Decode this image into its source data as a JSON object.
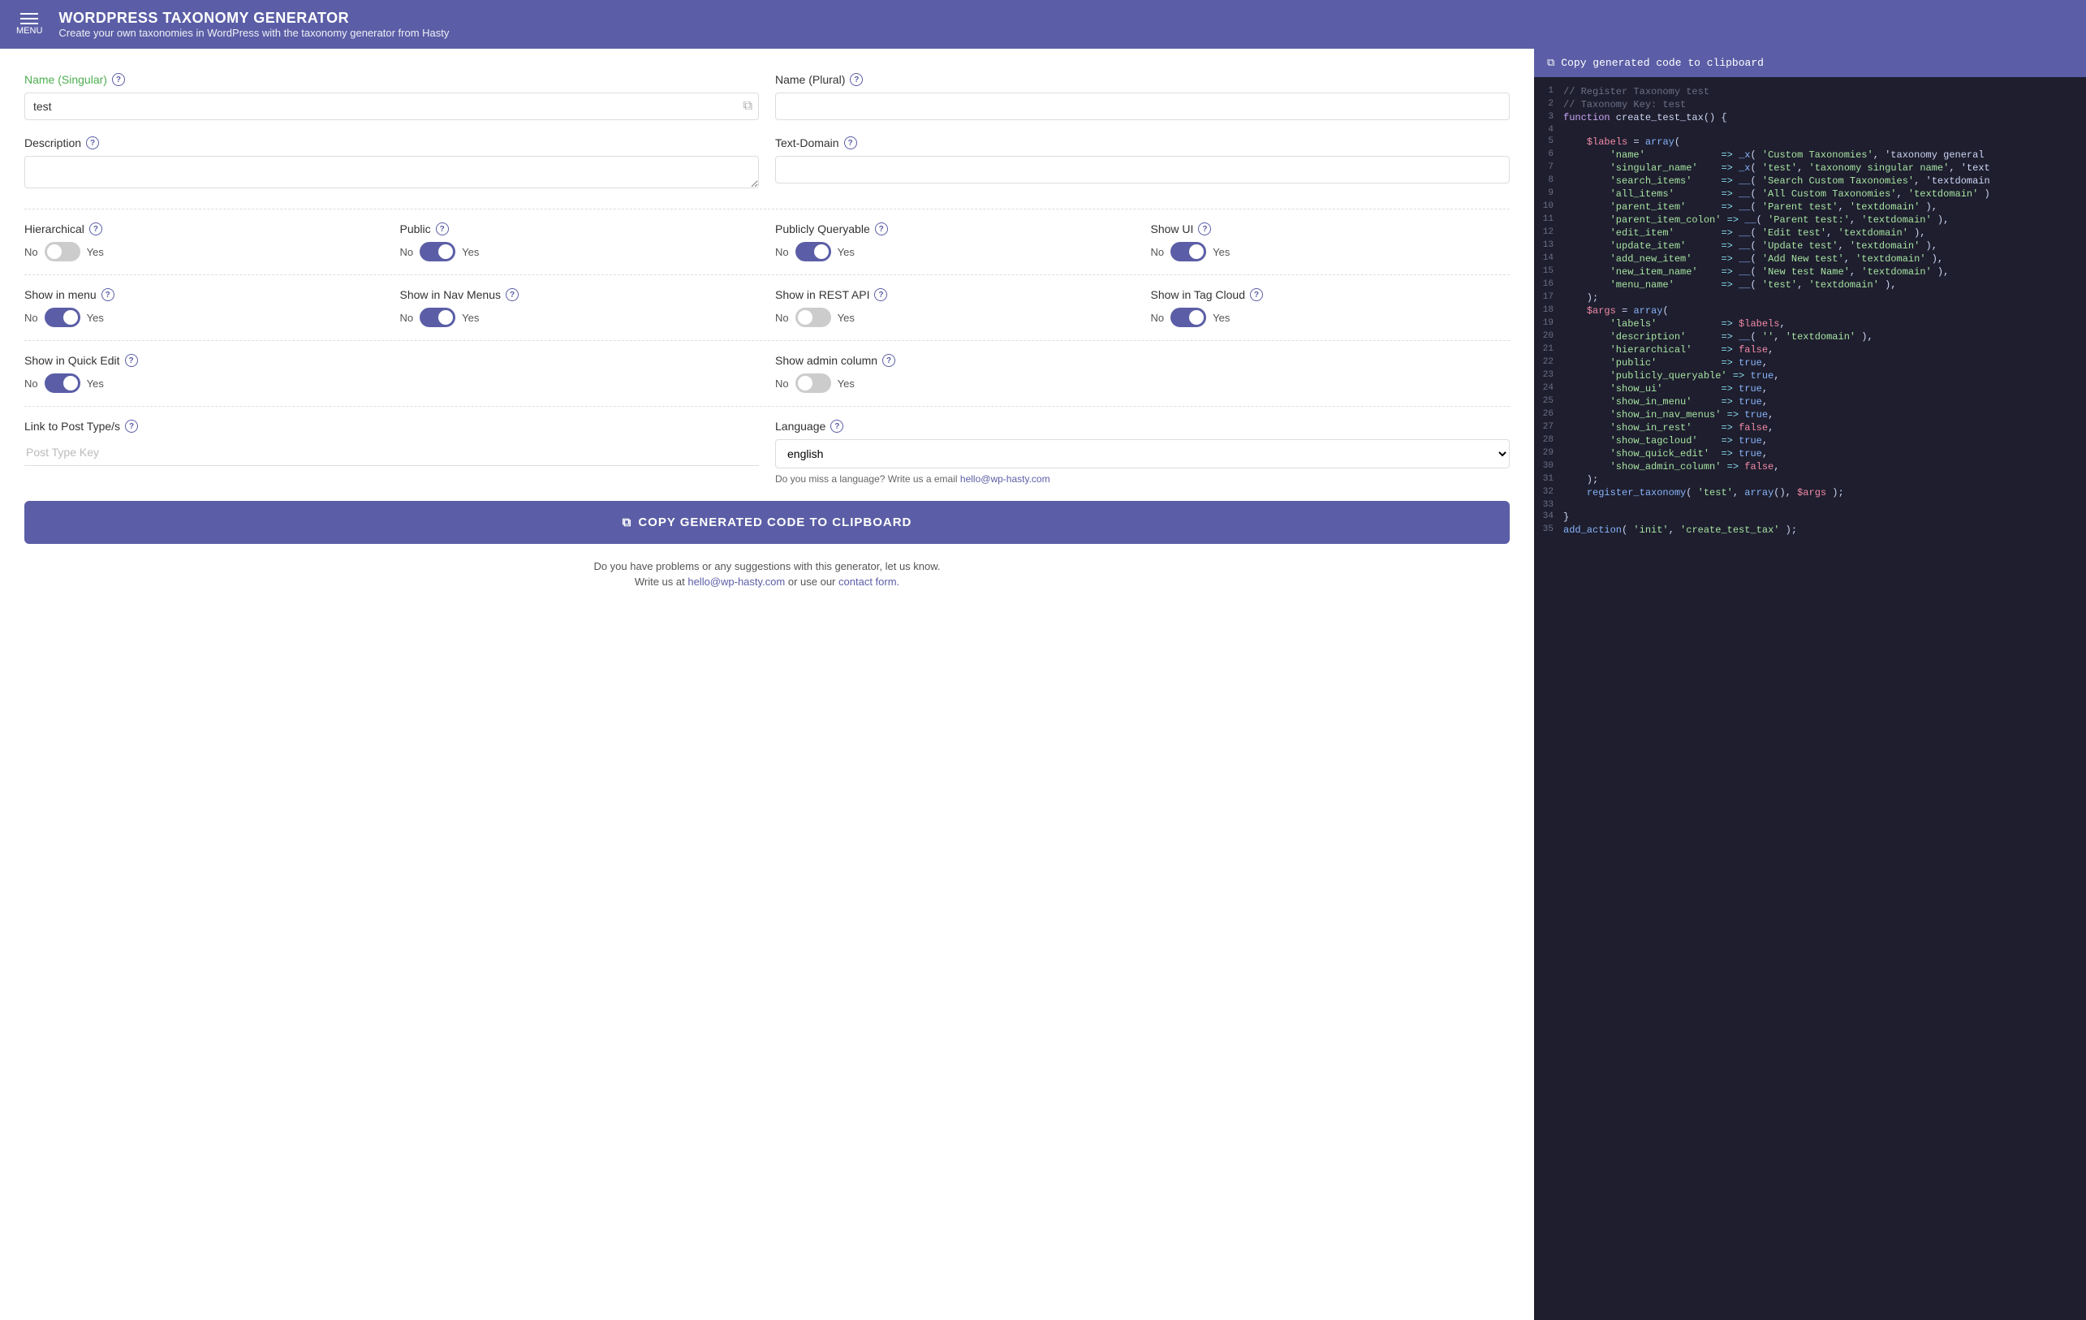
{
  "header": {
    "menu_label": "MENU",
    "title": "WORDPRESS TAXONOMY GENERATOR",
    "subtitle": "Create your own taxonomies in WordPress with the taxonomy generator from Hasty"
  },
  "form": {
    "name_singular_label": "Name (Singular)",
    "name_singular_value": "test",
    "name_plural_label": "Name (Plural)",
    "name_plural_value": "",
    "description_label": "Description",
    "description_value": "",
    "textdomain_label": "Text-Domain",
    "textdomain_value": "",
    "hierarchical_label": "Hierarchical",
    "public_label": "Public",
    "publicly_queryable_label": "Publicly Queryable",
    "show_ui_label": "Show UI",
    "show_in_menu_label": "Show in menu",
    "show_in_nav_menus_label": "Show in Nav Menus",
    "show_in_rest_api_label": "Show in REST API",
    "show_in_tag_cloud_label": "Show in Tag Cloud",
    "show_in_quick_edit_label": "Show in Quick Edit",
    "show_admin_column_label": "Show admin column",
    "link_to_post_types_label": "Link to Post Type/s",
    "post_type_placeholder": "Post Type Key",
    "language_label": "Language",
    "language_value": "english",
    "lang_hint": "Do you miss a language? Write us a email",
    "lang_email": "hello@wp-hasty.com",
    "no_label": "No",
    "yes_label": "Yes",
    "copy_button_label": "COPY GENERATED CODE TO CLIPBOARD",
    "footer_line1": "Do you have problems or any suggestions with this generator, let us know.",
    "footer_line2_pre": "Write us at",
    "footer_email": "hello@wp-hasty.com",
    "footer_mid": "or use our",
    "footer_link": "contact form.",
    "code_header_label": "Copy generated code to clipboard"
  },
  "toggles": {
    "hierarchical": false,
    "public": true,
    "publicly_queryable": true,
    "show_ui": true,
    "show_in_menu": true,
    "show_in_nav_menus": true,
    "show_in_rest": false,
    "show_in_tag_cloud": true,
    "show_in_quick_edit": true,
    "show_admin_column": false
  },
  "code_lines": [
    {
      "num": 1,
      "type": "comment",
      "text": "// Register Taxonomy test"
    },
    {
      "num": 2,
      "type": "comment",
      "text": "// Taxonomy Key: test"
    },
    {
      "num": 3,
      "type": "mixed",
      "text": "function create_test_tax() {"
    },
    {
      "num": 4,
      "type": "plain",
      "text": ""
    },
    {
      "num": 5,
      "type": "mixed",
      "text": "    $labels = array("
    },
    {
      "num": 6,
      "type": "key-val",
      "text": "        'name'             => _x( 'Custom Taxonomies', 'taxonomy general"
    },
    {
      "num": 7,
      "type": "key-val",
      "text": "        'singular_name'    => _x( 'test', 'taxonomy singular name', 'text"
    },
    {
      "num": 8,
      "type": "key-val",
      "text": "        'search_items'     => __( 'Search Custom Taxonomies', 'textdomain"
    },
    {
      "num": 9,
      "type": "key-val",
      "text": "        'all_items'        => __( 'All Custom Taxonomies', 'textdomain' )"
    },
    {
      "num": 10,
      "type": "key-val",
      "text": "        'parent_item'      => __( 'Parent test', 'textdomain' ),"
    },
    {
      "num": 11,
      "type": "key-val",
      "text": "        'parent_item_colon' => __( 'Parent test:', 'textdomain' ),"
    },
    {
      "num": 12,
      "type": "key-val",
      "text": "        'edit_item'        => __( 'Edit test', 'textdomain' ),"
    },
    {
      "num": 13,
      "type": "key-val",
      "text": "        'update_item'      => __( 'Update test', 'textdomain' ),"
    },
    {
      "num": 14,
      "type": "key-val",
      "text": "        'add_new_item'     => __( 'Add New test', 'textdomain' ),"
    },
    {
      "num": 15,
      "type": "key-val",
      "text": "        'new_item_name'    => __( 'New test Name', 'textdomain' ),"
    },
    {
      "num": 16,
      "type": "key-val",
      "text": "        'menu_name'        => __( 'test', 'textdomain' ),"
    },
    {
      "num": 17,
      "type": "plain",
      "text": "    );"
    },
    {
      "num": 18,
      "type": "mixed",
      "text": "    $args = array("
    },
    {
      "num": 19,
      "type": "key-val",
      "text": "        'labels'           => $labels,"
    },
    {
      "num": 20,
      "type": "key-val",
      "text": "        'description'      => __( '', 'textdomain' ),"
    },
    {
      "num": 21,
      "type": "key-val",
      "text": "        'hierarchical'     => false,"
    },
    {
      "num": 22,
      "type": "key-val",
      "text": "        'public'           => true,"
    },
    {
      "num": 23,
      "type": "key-val",
      "text": "        'publicly_queryable' => true,"
    },
    {
      "num": 24,
      "type": "key-val",
      "text": "        'show_ui'          => true,"
    },
    {
      "num": 25,
      "type": "key-val",
      "text": "        'show_in_menu'     => true,"
    },
    {
      "num": 26,
      "type": "key-val",
      "text": "        'show_in_nav_menus' => true,"
    },
    {
      "num": 27,
      "type": "key-val",
      "text": "        'show_in_rest'     => false,"
    },
    {
      "num": 28,
      "type": "key-val",
      "text": "        'show_tagcloud'    => true,"
    },
    {
      "num": 29,
      "type": "key-val",
      "text": "        'show_quick_edit'  => true,"
    },
    {
      "num": 30,
      "type": "key-val",
      "text": "        'show_admin_column' => false,"
    },
    {
      "num": 31,
      "type": "plain",
      "text": "    );"
    },
    {
      "num": 32,
      "type": "register",
      "text": "    register_taxonomy( 'test', array(), $args );"
    },
    {
      "num": 33,
      "type": "plain",
      "text": ""
    },
    {
      "num": 34,
      "type": "plain",
      "text": "}"
    },
    {
      "num": 35,
      "type": "add_action",
      "text": "add_action( 'init', 'create_test_tax' );"
    }
  ]
}
